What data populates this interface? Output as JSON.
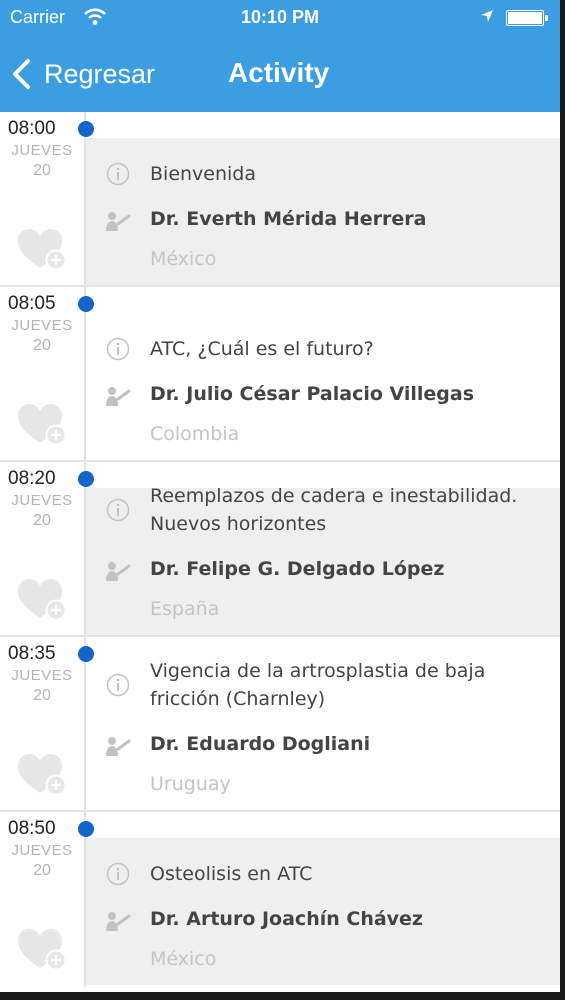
{
  "status_bar": {
    "carrier": "Carrier",
    "time": "10:10 PM"
  },
  "nav": {
    "back_label": "Regresar",
    "title": "Activity"
  },
  "colors": {
    "header": "#3d9de3",
    "dot": "#1565c8",
    "shaded_card": "#efefef"
  },
  "events": [
    {
      "time": "08:00",
      "day": "JUEVES",
      "date": "20",
      "talk": "Bienvenida",
      "speaker": "Dr.  Everth Mérida Herrera",
      "country": "México"
    },
    {
      "time": "08:05",
      "day": "JUEVES",
      "date": "20",
      "talk": "ATC, ¿Cuál es el futuro?",
      "speaker": "Dr.  Julio César Palacio Villegas",
      "country": "Colombia"
    },
    {
      "time": "08:20",
      "day": "JUEVES",
      "date": "20",
      "talk": "Reemplazos de cadera e inestabilidad. Nuevos horizontes",
      "speaker": "Dr.  Felipe G. Delgado López",
      "country": "España"
    },
    {
      "time": "08:35",
      "day": "JUEVES",
      "date": "20",
      "talk": "Vigencia de la artrosplastia de baja fricción (Charnley)",
      "speaker": "Dr.  Eduardo Dogliani",
      "country": "Uruguay"
    },
    {
      "time": "08:50",
      "day": "JUEVES",
      "date": "20",
      "talk": "Osteolisis en ATC",
      "speaker": "Dr.  Arturo Joachín Chávez",
      "country": "México"
    }
  ]
}
